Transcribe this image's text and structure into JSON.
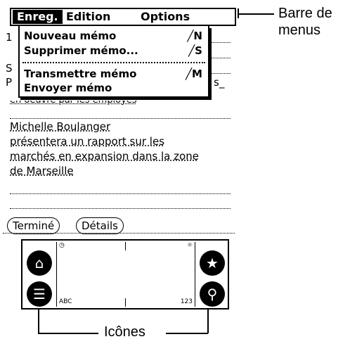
{
  "menubar": {
    "record": "Enreg.",
    "edit": "Edition",
    "options": "Options"
  },
  "menu": {
    "items": [
      {
        "label": "Nouveau mémo",
        "shortcut": "╱N"
      },
      {
        "label": "Supprimer mémo...",
        "shortcut": "╱S"
      },
      {
        "label": "Transmettre mémo",
        "shortcut": "╱M"
      },
      {
        "label": "Envoyer mémo",
        "shortcut": ""
      }
    ]
  },
  "memo": {
    "clipped_left": [
      "1",
      "S",
      "P"
    ],
    "clipped_right": [
      "s_"
    ],
    "partial_line": "en oeuvre par les employés",
    "lines": [
      "Michelle Boulanger",
      "présentera un rapport sur les",
      "marchés en expansion dans la zone",
      "de Marseille"
    ]
  },
  "buttons": {
    "done": "Terminé",
    "details": "Détails"
  },
  "graffiti": {
    "left_label": "ABC",
    "right_label": "123"
  },
  "icons": [
    "home-icon",
    "menu-icon",
    "favorite-icon",
    "find-icon"
  ],
  "callouts": {
    "menu_bar_line1": "Barre de",
    "menu_bar_line2": "menus",
    "icons": "Icônes"
  }
}
